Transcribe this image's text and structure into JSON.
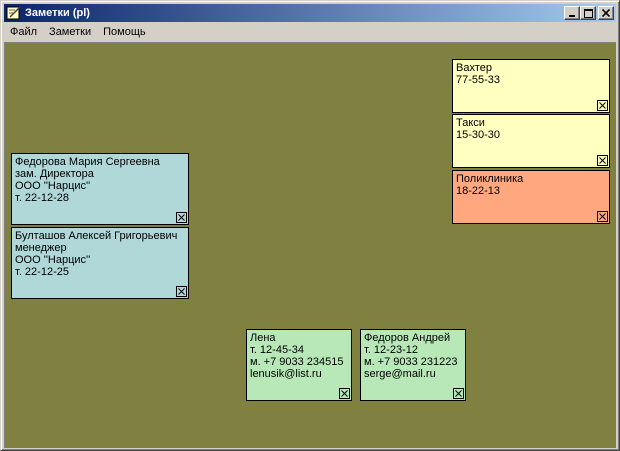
{
  "window": {
    "title": "Заметки (pl)",
    "icon": "notes-app-icon"
  },
  "menu": {
    "items": [
      "Файл",
      "Заметки",
      "Помощь"
    ]
  },
  "colors": {
    "workspace": "#808040",
    "note_yellow": "#ffffc0",
    "note_salmon": "#ffa880",
    "note_blue": "#b0d8d8",
    "note_green": "#b8e8b8"
  },
  "notes": [
    {
      "lines": [
        "Вахтер",
        "77-55-33"
      ],
      "color": "yellow"
    },
    {
      "lines": [
        "Такси",
        "15-30-30"
      ],
      "color": "yellow"
    },
    {
      "lines": [
        "Поликлиника",
        "18-22-13"
      ],
      "color": "salmon"
    },
    {
      "lines": [
        "Федорова Мария Сергеевна",
        "зам. Директора",
        "ООО ''Нарцис''",
        "т. 22-12-28"
      ],
      "color": "blue"
    },
    {
      "lines": [
        "Булташов Алексей Григорьевич",
        "менеджер",
        "ООО ''Нарцис''",
        "т. 22-12-25"
      ],
      "color": "blue"
    },
    {
      "lines": [
        "Лена",
        "т. 12-45-34",
        "м. +7 9033 234515",
        "lenusik@list.ru"
      ],
      "color": "green"
    },
    {
      "lines": [
        "Федоров Андрей",
        "т. 12-23-12",
        "м. +7 9033 231223",
        "serge@mail.ru"
      ],
      "color": "green"
    }
  ]
}
